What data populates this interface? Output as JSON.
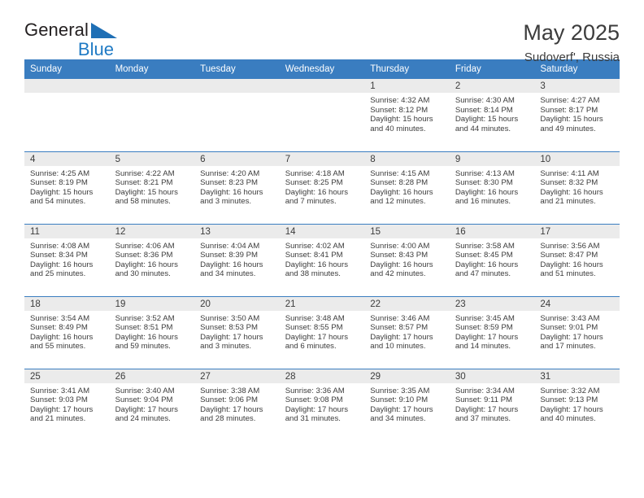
{
  "brand": {
    "line1": "General",
    "line2": "Blue",
    "triangle_color": "#1f6fb5",
    "text_color": "#231f20",
    "accent_color": "#1f7ac4"
  },
  "header": {
    "title": "May 2025",
    "subtitle": "Sudoverf', Russia"
  },
  "theme": {
    "header_bg": "#3a7dc0",
    "header_text": "#ffffff",
    "cell_shade": "#ebebeb",
    "grid_line": "#3a7dc0",
    "body_text": "#3c3c3c"
  },
  "weekdays": [
    "Sunday",
    "Monday",
    "Tuesday",
    "Wednesday",
    "Thursday",
    "Friday",
    "Saturday"
  ],
  "labels": {
    "sunrise": "Sunrise:",
    "sunset": "Sunset:",
    "daylight": "Daylight:"
  },
  "weeks": [
    [
      {
        "day": "",
        "sunrise": "",
        "sunset": "",
        "daylight_1": "",
        "daylight_2": ""
      },
      {
        "day": "",
        "sunrise": "",
        "sunset": "",
        "daylight_1": "",
        "daylight_2": ""
      },
      {
        "day": "",
        "sunrise": "",
        "sunset": "",
        "daylight_1": "",
        "daylight_2": ""
      },
      {
        "day": "",
        "sunrise": "",
        "sunset": "",
        "daylight_1": "",
        "daylight_2": ""
      },
      {
        "day": "1",
        "sunrise": "Sunrise: 4:32 AM",
        "sunset": "Sunset: 8:12 PM",
        "daylight_1": "Daylight: 15 hours",
        "daylight_2": "and 40 minutes."
      },
      {
        "day": "2",
        "sunrise": "Sunrise: 4:30 AM",
        "sunset": "Sunset: 8:14 PM",
        "daylight_1": "Daylight: 15 hours",
        "daylight_2": "and 44 minutes."
      },
      {
        "day": "3",
        "sunrise": "Sunrise: 4:27 AM",
        "sunset": "Sunset: 8:17 PM",
        "daylight_1": "Daylight: 15 hours",
        "daylight_2": "and 49 minutes."
      }
    ],
    [
      {
        "day": "4",
        "sunrise": "Sunrise: 4:25 AM",
        "sunset": "Sunset: 8:19 PM",
        "daylight_1": "Daylight: 15 hours",
        "daylight_2": "and 54 minutes."
      },
      {
        "day": "5",
        "sunrise": "Sunrise: 4:22 AM",
        "sunset": "Sunset: 8:21 PM",
        "daylight_1": "Daylight: 15 hours",
        "daylight_2": "and 58 minutes."
      },
      {
        "day": "6",
        "sunrise": "Sunrise: 4:20 AM",
        "sunset": "Sunset: 8:23 PM",
        "daylight_1": "Daylight: 16 hours",
        "daylight_2": "and 3 minutes."
      },
      {
        "day": "7",
        "sunrise": "Sunrise: 4:18 AM",
        "sunset": "Sunset: 8:25 PM",
        "daylight_1": "Daylight: 16 hours",
        "daylight_2": "and 7 minutes."
      },
      {
        "day": "8",
        "sunrise": "Sunrise: 4:15 AM",
        "sunset": "Sunset: 8:28 PM",
        "daylight_1": "Daylight: 16 hours",
        "daylight_2": "and 12 minutes."
      },
      {
        "day": "9",
        "sunrise": "Sunrise: 4:13 AM",
        "sunset": "Sunset: 8:30 PM",
        "daylight_1": "Daylight: 16 hours",
        "daylight_2": "and 16 minutes."
      },
      {
        "day": "10",
        "sunrise": "Sunrise: 4:11 AM",
        "sunset": "Sunset: 8:32 PM",
        "daylight_1": "Daylight: 16 hours",
        "daylight_2": "and 21 minutes."
      }
    ],
    [
      {
        "day": "11",
        "sunrise": "Sunrise: 4:08 AM",
        "sunset": "Sunset: 8:34 PM",
        "daylight_1": "Daylight: 16 hours",
        "daylight_2": "and 25 minutes."
      },
      {
        "day": "12",
        "sunrise": "Sunrise: 4:06 AM",
        "sunset": "Sunset: 8:36 PM",
        "daylight_1": "Daylight: 16 hours",
        "daylight_2": "and 30 minutes."
      },
      {
        "day": "13",
        "sunrise": "Sunrise: 4:04 AM",
        "sunset": "Sunset: 8:39 PM",
        "daylight_1": "Daylight: 16 hours",
        "daylight_2": "and 34 minutes."
      },
      {
        "day": "14",
        "sunrise": "Sunrise: 4:02 AM",
        "sunset": "Sunset: 8:41 PM",
        "daylight_1": "Daylight: 16 hours",
        "daylight_2": "and 38 minutes."
      },
      {
        "day": "15",
        "sunrise": "Sunrise: 4:00 AM",
        "sunset": "Sunset: 8:43 PM",
        "daylight_1": "Daylight: 16 hours",
        "daylight_2": "and 42 minutes."
      },
      {
        "day": "16",
        "sunrise": "Sunrise: 3:58 AM",
        "sunset": "Sunset: 8:45 PM",
        "daylight_1": "Daylight: 16 hours",
        "daylight_2": "and 47 minutes."
      },
      {
        "day": "17",
        "sunrise": "Sunrise: 3:56 AM",
        "sunset": "Sunset: 8:47 PM",
        "daylight_1": "Daylight: 16 hours",
        "daylight_2": "and 51 minutes."
      }
    ],
    [
      {
        "day": "18",
        "sunrise": "Sunrise: 3:54 AM",
        "sunset": "Sunset: 8:49 PM",
        "daylight_1": "Daylight: 16 hours",
        "daylight_2": "and 55 minutes."
      },
      {
        "day": "19",
        "sunrise": "Sunrise: 3:52 AM",
        "sunset": "Sunset: 8:51 PM",
        "daylight_1": "Daylight: 16 hours",
        "daylight_2": "and 59 minutes."
      },
      {
        "day": "20",
        "sunrise": "Sunrise: 3:50 AM",
        "sunset": "Sunset: 8:53 PM",
        "daylight_1": "Daylight: 17 hours",
        "daylight_2": "and 3 minutes."
      },
      {
        "day": "21",
        "sunrise": "Sunrise: 3:48 AM",
        "sunset": "Sunset: 8:55 PM",
        "daylight_1": "Daylight: 17 hours",
        "daylight_2": "and 6 minutes."
      },
      {
        "day": "22",
        "sunrise": "Sunrise: 3:46 AM",
        "sunset": "Sunset: 8:57 PM",
        "daylight_1": "Daylight: 17 hours",
        "daylight_2": "and 10 minutes."
      },
      {
        "day": "23",
        "sunrise": "Sunrise: 3:45 AM",
        "sunset": "Sunset: 8:59 PM",
        "daylight_1": "Daylight: 17 hours",
        "daylight_2": "and 14 minutes."
      },
      {
        "day": "24",
        "sunrise": "Sunrise: 3:43 AM",
        "sunset": "Sunset: 9:01 PM",
        "daylight_1": "Daylight: 17 hours",
        "daylight_2": "and 17 minutes."
      }
    ],
    [
      {
        "day": "25",
        "sunrise": "Sunrise: 3:41 AM",
        "sunset": "Sunset: 9:03 PM",
        "daylight_1": "Daylight: 17 hours",
        "daylight_2": "and 21 minutes."
      },
      {
        "day": "26",
        "sunrise": "Sunrise: 3:40 AM",
        "sunset": "Sunset: 9:04 PM",
        "daylight_1": "Daylight: 17 hours",
        "daylight_2": "and 24 minutes."
      },
      {
        "day": "27",
        "sunrise": "Sunrise: 3:38 AM",
        "sunset": "Sunset: 9:06 PM",
        "daylight_1": "Daylight: 17 hours",
        "daylight_2": "and 28 minutes."
      },
      {
        "day": "28",
        "sunrise": "Sunrise: 3:36 AM",
        "sunset": "Sunset: 9:08 PM",
        "daylight_1": "Daylight: 17 hours",
        "daylight_2": "and 31 minutes."
      },
      {
        "day": "29",
        "sunrise": "Sunrise: 3:35 AM",
        "sunset": "Sunset: 9:10 PM",
        "daylight_1": "Daylight: 17 hours",
        "daylight_2": "and 34 minutes."
      },
      {
        "day": "30",
        "sunrise": "Sunrise: 3:34 AM",
        "sunset": "Sunset: 9:11 PM",
        "daylight_1": "Daylight: 17 hours",
        "daylight_2": "and 37 minutes."
      },
      {
        "day": "31",
        "sunrise": "Sunrise: 3:32 AM",
        "sunset": "Sunset: 9:13 PM",
        "daylight_1": "Daylight: 17 hours",
        "daylight_2": "and 40 minutes."
      }
    ]
  ]
}
